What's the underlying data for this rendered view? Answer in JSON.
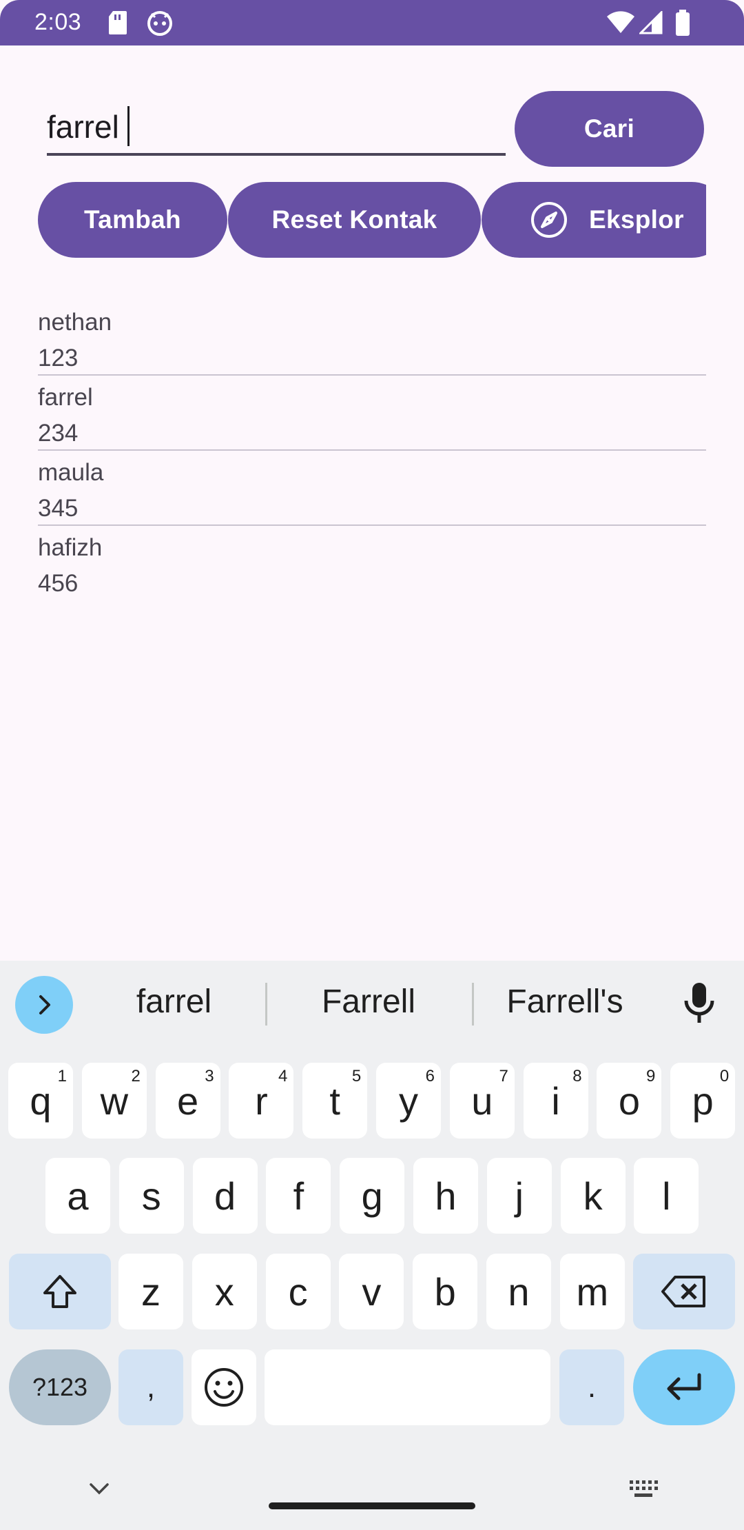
{
  "status": {
    "time": "2:03"
  },
  "search": {
    "value": "farrel"
  },
  "buttons": {
    "search": "Cari",
    "add": "Tambah",
    "reset": "Reset Kontak",
    "explore": "Eksplor"
  },
  "contacts": [
    {
      "name": "nethan",
      "number": "123"
    },
    {
      "name": "farrel",
      "number": "234"
    },
    {
      "name": "maula",
      "number": "345"
    },
    {
      "name": "hafizh",
      "number": "456"
    }
  ],
  "keyboard": {
    "suggestions": [
      "farrel",
      "Farrell",
      "Farrell's"
    ],
    "row1": [
      {
        "k": "q",
        "h": "1"
      },
      {
        "k": "w",
        "h": "2"
      },
      {
        "k": "e",
        "h": "3"
      },
      {
        "k": "r",
        "h": "4"
      },
      {
        "k": "t",
        "h": "5"
      },
      {
        "k": "y",
        "h": "6"
      },
      {
        "k": "u",
        "h": "7"
      },
      {
        "k": "i",
        "h": "8"
      },
      {
        "k": "o",
        "h": "9"
      },
      {
        "k": "p",
        "h": "0"
      }
    ],
    "row2": [
      "a",
      "s",
      "d",
      "f",
      "g",
      "h",
      "j",
      "k",
      "l"
    ],
    "row3": [
      "z",
      "x",
      "c",
      "v",
      "b",
      "n",
      "m"
    ],
    "symbols": "?123",
    "comma": ",",
    "period": "."
  },
  "colors": {
    "primary": "#6750a4",
    "background": "#fdf7fc",
    "key_accent": "#7fcff8",
    "key_mod": "#d3e3f4"
  }
}
